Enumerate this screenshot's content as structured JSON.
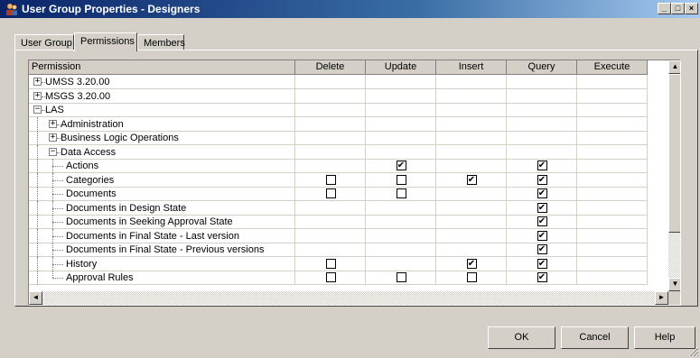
{
  "window": {
    "title": "User Group Properties - Designers",
    "controls": {
      "minimize": "_",
      "maximize": "□",
      "close": "×"
    }
  },
  "tabs": [
    {
      "label": "User Group",
      "active": false
    },
    {
      "label": "Permissions",
      "active": true
    },
    {
      "label": "Members",
      "active": false
    }
  ],
  "grid": {
    "columns": [
      "Permission",
      "Delete",
      "Update",
      "Insert",
      "Query",
      "Execute"
    ],
    "rows": [
      {
        "label": "UMSS 3.20.00",
        "level": 0,
        "expander": "plus",
        "checks": [
          null,
          null,
          null,
          null,
          null
        ]
      },
      {
        "label": "MSGS 3.20.00",
        "level": 0,
        "expander": "plus",
        "checks": [
          null,
          null,
          null,
          null,
          null
        ]
      },
      {
        "label": "LAS",
        "level": 0,
        "expander": "minus",
        "checks": [
          null,
          null,
          null,
          null,
          null
        ]
      },
      {
        "label": "Administration",
        "level": 1,
        "expander": "plus",
        "checks": [
          null,
          null,
          null,
          null,
          null
        ]
      },
      {
        "label": "Business Logic Operations",
        "level": 1,
        "expander": "plus",
        "checks": [
          null,
          null,
          null,
          null,
          null
        ]
      },
      {
        "label": "Data Access",
        "level": 1,
        "expander": "minus",
        "checks": [
          null,
          null,
          null,
          null,
          null
        ]
      },
      {
        "label": "Actions",
        "level": 2,
        "expander": "none",
        "checks": [
          null,
          true,
          null,
          true,
          null
        ]
      },
      {
        "label": "Categories",
        "level": 2,
        "expander": "none",
        "checks": [
          false,
          false,
          true,
          true,
          null
        ]
      },
      {
        "label": "Documents",
        "level": 2,
        "expander": "none",
        "checks": [
          false,
          false,
          null,
          true,
          null
        ]
      },
      {
        "label": "Documents in Design State",
        "level": 2,
        "expander": "none",
        "checks": [
          null,
          null,
          null,
          true,
          null
        ]
      },
      {
        "label": "Documents in Seeking Approval State",
        "level": 2,
        "expander": "none",
        "checks": [
          null,
          null,
          null,
          true,
          null
        ]
      },
      {
        "label": "Documents in Final State - Last version",
        "level": 2,
        "expander": "none",
        "checks": [
          null,
          null,
          null,
          true,
          null
        ]
      },
      {
        "label": "Documents in Final State - Previous versions",
        "level": 2,
        "expander": "none",
        "checks": [
          null,
          null,
          null,
          true,
          null
        ]
      },
      {
        "label": "History",
        "level": 2,
        "expander": "none",
        "checks": [
          false,
          null,
          true,
          true,
          null
        ]
      },
      {
        "label": "Approval Rules",
        "level": 2,
        "expander": "none",
        "checks": [
          false,
          false,
          false,
          true,
          null
        ]
      }
    ]
  },
  "scroll_icons": {
    "up": "▲",
    "down": "▼",
    "left": "◄",
    "right": "►"
  },
  "buttons": {
    "ok": "OK",
    "cancel": "Cancel",
    "help": "Help"
  },
  "icons": {
    "app": "user-group-icon",
    "check": "✔"
  },
  "colors": {
    "titlebar": "#0a246a",
    "face": "#d4d0c8"
  }
}
